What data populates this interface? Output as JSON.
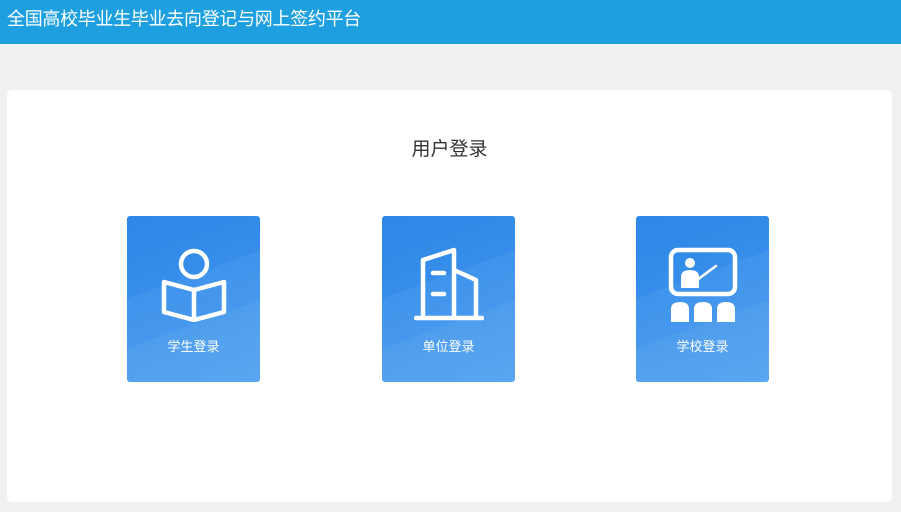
{
  "header": {
    "title": "全国高校毕业生毕业去向登记与网上签约平台"
  },
  "panel": {
    "title": "用户登录"
  },
  "tiles": [
    {
      "label": "学生登录",
      "icon": "student-reading-icon"
    },
    {
      "label": "单位登录",
      "icon": "building-icon"
    },
    {
      "label": "学校登录",
      "icon": "teacher-board-icon"
    }
  ],
  "colors": {
    "header_bg": "#1ea0e0",
    "tile_bg": "#3a8fea",
    "page_bg": "#f1f1f1",
    "card_bg": "#ffffff"
  }
}
